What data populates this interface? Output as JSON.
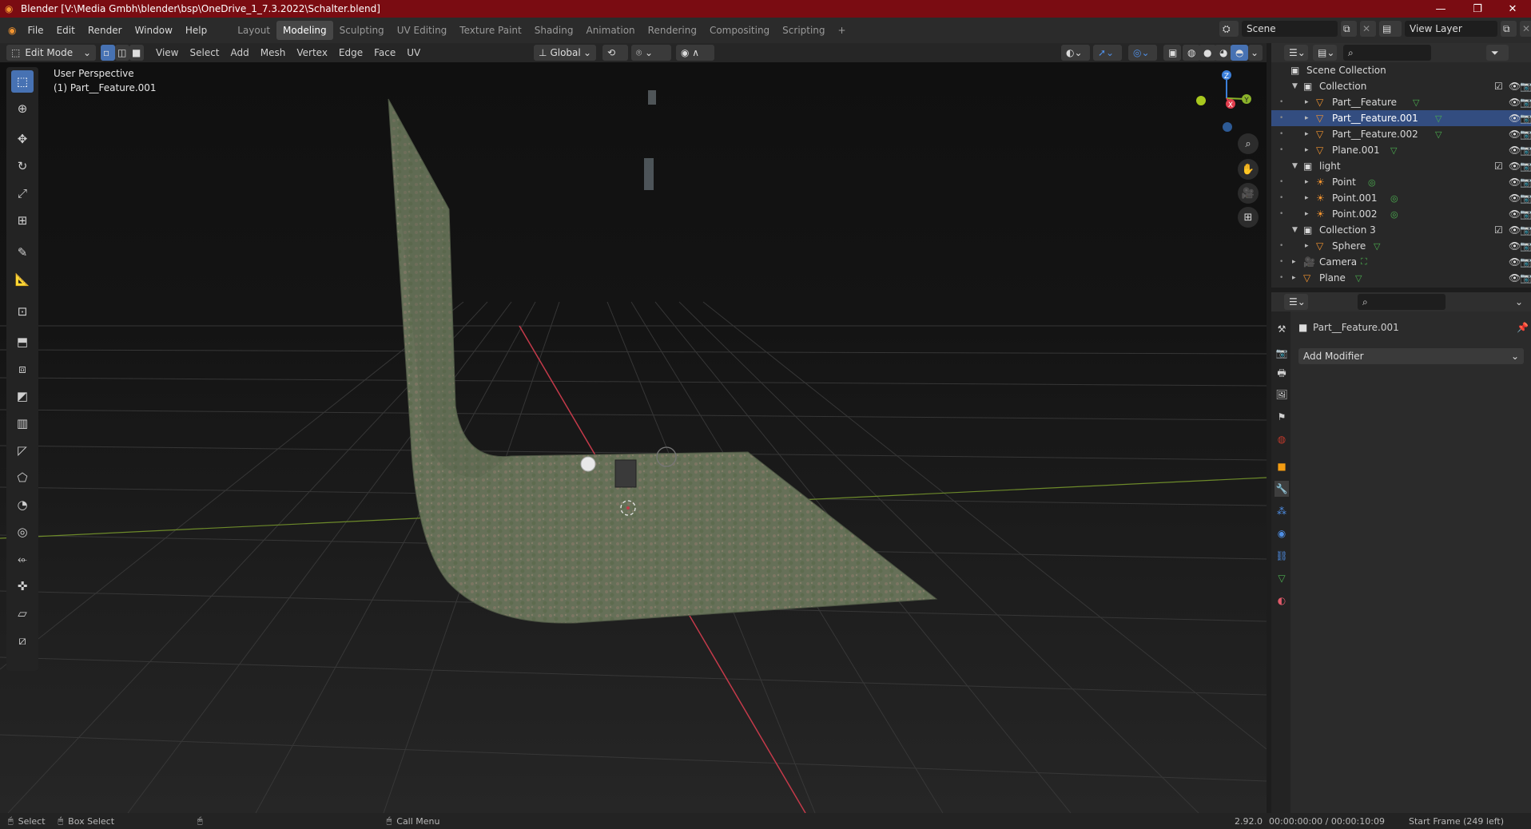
{
  "window": {
    "title": "Blender [V:\\Media Gmbh\\blender\\bsp\\OneDrive_1_7.3.2022\\Schalter.blend]"
  },
  "menu": {
    "file": "File",
    "edit": "Edit",
    "render": "Render",
    "window": "Window",
    "help": "Help"
  },
  "workspaces": [
    "Layout",
    "Modeling",
    "Sculpting",
    "UV Editing",
    "Texture Paint",
    "Shading",
    "Animation",
    "Rendering",
    "Compositing",
    "Scripting"
  ],
  "active_workspace": "Modeling",
  "scene": {
    "label": "Scene",
    "view_layer": "View Layer"
  },
  "header": {
    "mode": "Edit Mode",
    "view": "View",
    "select": "Select",
    "add": "Add",
    "mesh": "Mesh",
    "vertex": "Vertex",
    "edge": "Edge",
    "face": "Face",
    "uv": "UV",
    "transform": "Global"
  },
  "viewport": {
    "perspective": "User Perspective",
    "object": "(1) Part__Feature.001",
    "gizmo": {
      "x": "X",
      "y": "Y",
      "z": "Z"
    }
  },
  "outliner": {
    "root": "Scene Collection",
    "rows": [
      {
        "label": "Collection",
        "type": "collection",
        "indent": 1
      },
      {
        "label": "Part__Feature",
        "type": "mesh",
        "indent": 2
      },
      {
        "label": "Part__Feature.001",
        "type": "mesh",
        "indent": 2,
        "selected": true
      },
      {
        "label": "Part__Feature.002",
        "type": "mesh",
        "indent": 2
      },
      {
        "label": "Plane.001",
        "type": "mesh",
        "indent": 2
      },
      {
        "label": "light",
        "type": "collection",
        "indent": 1
      },
      {
        "label": "Point",
        "type": "light",
        "indent": 2
      },
      {
        "label": "Point.001",
        "type": "light",
        "indent": 2
      },
      {
        "label": "Point.002",
        "type": "light",
        "indent": 2
      },
      {
        "label": "Collection 3",
        "type": "collection",
        "indent": 1
      },
      {
        "label": "Sphere",
        "type": "mesh",
        "indent": 2
      },
      {
        "label": "Camera",
        "type": "camera",
        "indent": 1
      },
      {
        "label": "Plane",
        "type": "mesh",
        "indent": 1
      }
    ]
  },
  "properties": {
    "object_name": "Part__Feature.001",
    "add_modifier": "Add Modifier"
  },
  "status": {
    "select": "Select",
    "box_select": "Box Select",
    "call_menu": "Call Menu",
    "version": "2.92.0",
    "time": "00:00:00:00 / 00:00:10:09",
    "frame": "Start Frame (249 left)"
  },
  "colors": {
    "title_bar": "#7a0c12",
    "selection": "#4772b3",
    "x_axis": "#e03c4c",
    "y_axis": "#8bb32a",
    "z_axis": "#3b7fd9"
  }
}
